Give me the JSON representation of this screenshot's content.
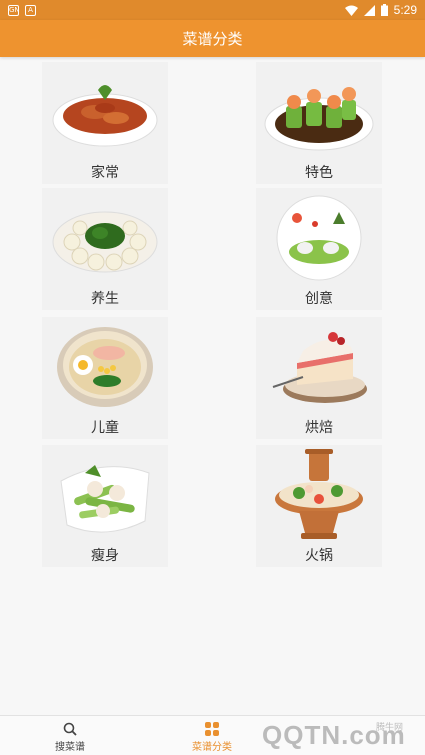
{
  "status_bar": {
    "time": "5:29",
    "left_icon_1": "GN",
    "left_icon_2": "A"
  },
  "app_bar": {
    "title": "菜谱分类"
  },
  "categories": [
    {
      "label": "家常",
      "icon": "braised-dish-image"
    },
    {
      "label": "特色",
      "icon": "shrimp-cucumber-image"
    },
    {
      "label": "养生",
      "icon": "yam-broccoli-image"
    },
    {
      "label": "创意",
      "icon": "creative-plate-image"
    },
    {
      "label": "儿童",
      "icon": "kids-noodle-bowl-image"
    },
    {
      "label": "烘焙",
      "icon": "cake-slice-image"
    },
    {
      "label": "瘦身",
      "icon": "celery-shrimp-image"
    },
    {
      "label": "火锅",
      "icon": "hotpot-image"
    }
  ],
  "bottom_nav": {
    "items": [
      {
        "label": "搜菜谱",
        "icon": "search-icon"
      },
      {
        "label": "菜谱分类",
        "icon": "grid-icon"
      }
    ]
  },
  "watermark": {
    "text": "QQTN.com",
    "small": "腾牛网"
  },
  "colors": {
    "accent": "#ee932f",
    "status_bar": "#e08a2c"
  }
}
